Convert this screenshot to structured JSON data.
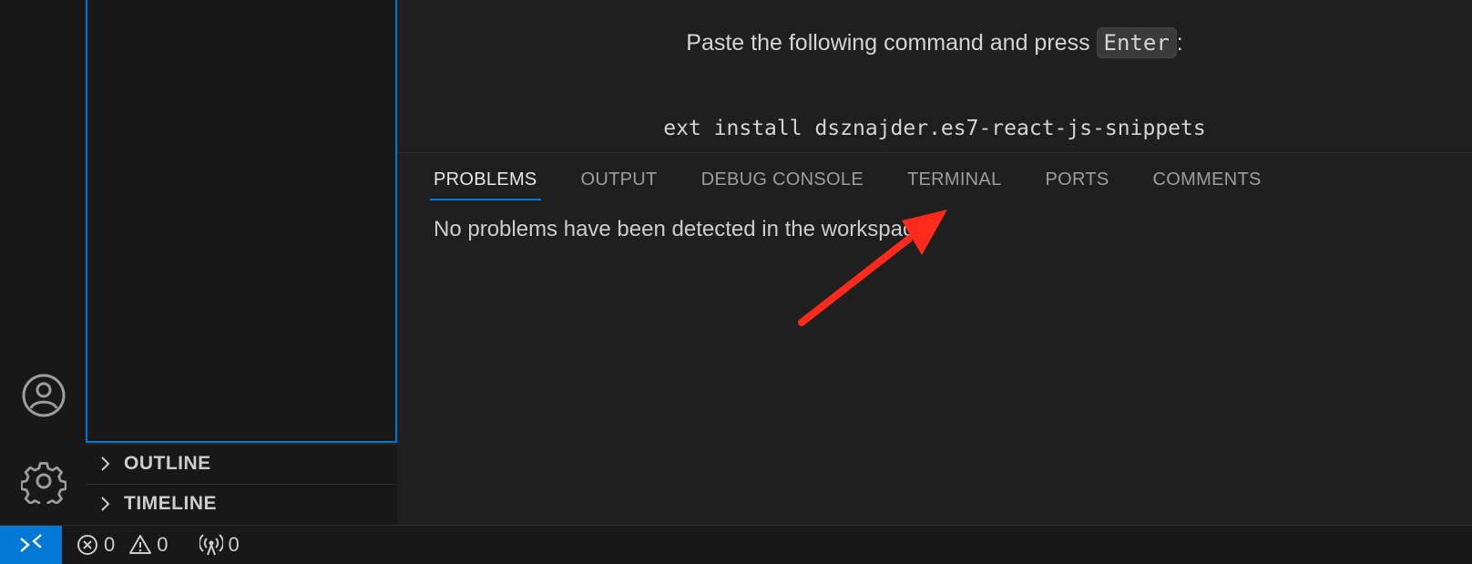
{
  "sidebar": {
    "sections": [
      {
        "label": "OUTLINE"
      },
      {
        "label": "TIMELINE"
      }
    ]
  },
  "editor": {
    "instruction_before": "Paste the following command and press ",
    "key": "Enter",
    "instruction_after": ":",
    "command": "ext install dsznajder.es7-react-js-snippets"
  },
  "panel": {
    "tabs": [
      {
        "label": "PROBLEMS",
        "active": true
      },
      {
        "label": "OUTPUT"
      },
      {
        "label": "DEBUG CONSOLE"
      },
      {
        "label": "TERMINAL"
      },
      {
        "label": "PORTS"
      },
      {
        "label": "COMMENTS"
      }
    ],
    "message": "No problems have been detected in the workspace."
  },
  "statusbar": {
    "errors": "0",
    "warnings": "0",
    "ports": "0"
  },
  "colors": {
    "accent": "#0078d4",
    "annotation_arrow": "#ff2a1a"
  }
}
